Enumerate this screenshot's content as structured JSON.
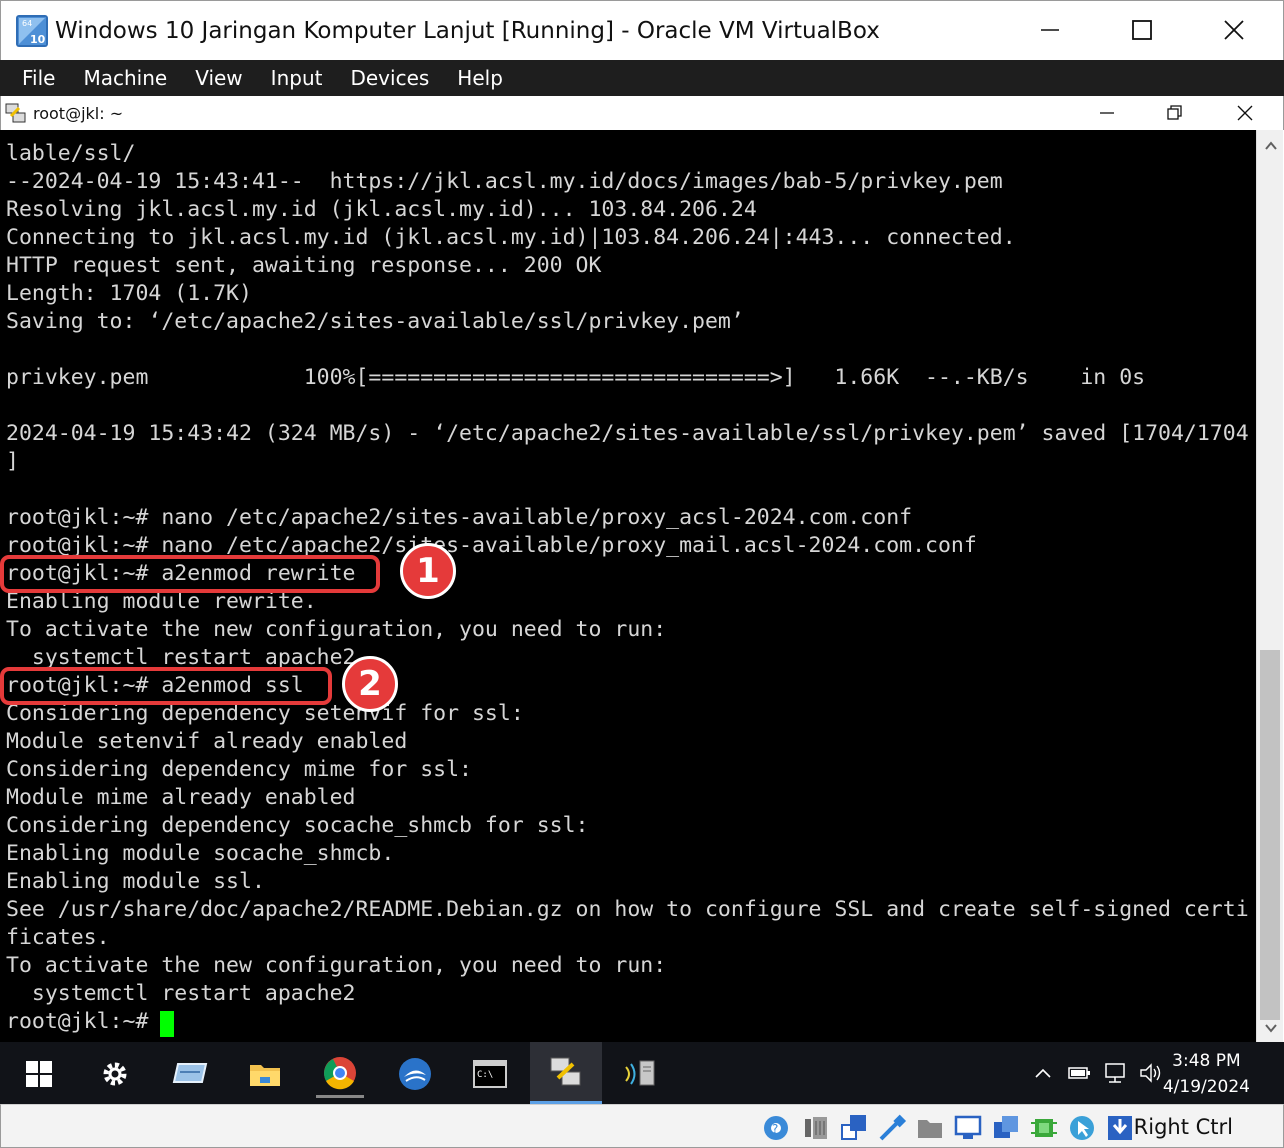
{
  "window": {
    "title": "Windows 10 Jaringan Komputer Lanjut [Running] - Oracle VM VirtualBox",
    "icon_badge_top": "64",
    "icon_badge_bottom": "10"
  },
  "menubar": {
    "items": [
      {
        "label": "File"
      },
      {
        "label": "Machine"
      },
      {
        "label": "View"
      },
      {
        "label": "Input"
      },
      {
        "label": "Devices"
      },
      {
        "label": "Help"
      }
    ]
  },
  "putty": {
    "title": "root@jkl: ~"
  },
  "terminal": {
    "lines": [
      "lable/ssl/",
      "--2024-04-19 15:43:41--  https://jkl.acsl.my.id/docs/images/bab-5/privkey.pem",
      "Resolving jkl.acsl.my.id (jkl.acsl.my.id)... 103.84.206.24",
      "Connecting to jkl.acsl.my.id (jkl.acsl.my.id)|103.84.206.24|:443... connected.",
      "HTTP request sent, awaiting response... 200 OK",
      "Length: 1704 (1.7K)",
      "Saving to: ‘/etc/apache2/sites-available/ssl/privkey.pem’",
      "",
      "privkey.pem            100%[===============================>]   1.66K  --.-KB/s    in 0s",
      "",
      "2024-04-19 15:43:42 (324 MB/s) - ‘/etc/apache2/sites-available/ssl/privkey.pem’ saved [1704/1704",
      "]",
      "",
      "root@jkl:~# nano /etc/apache2/sites-available/proxy_acsl-2024.com.conf",
      "root@jkl:~# nano /etc/apache2/sites-available/proxy_mail.acsl-2024.com.conf",
      "root@jkl:~# a2enmod rewrite",
      "Enabling module rewrite.",
      "To activate the new configuration, you need to run:",
      "  systemctl restart apache2",
      "root@jkl:~# a2enmod ssl",
      "Considering dependency setenvif for ssl:",
      "Module setenvif already enabled",
      "Considering dependency mime for ssl:",
      "Module mime already enabled",
      "Considering dependency socache_shmcb for ssl:",
      "Enabling module socache_shmcb.",
      "Enabling module ssl.",
      "See /usr/share/doc/apache2/README.Debian.gz on how to configure SSL and create self-signed certi",
      "ficates.",
      "To activate the new configuration, you need to run:",
      "  systemctl restart apache2",
      "root@jkl:~# "
    ]
  },
  "annotations": {
    "badge1": "1",
    "badge2": "2"
  },
  "taskbar": {
    "clock_time": "3:48 PM",
    "clock_date": "4/19/2024",
    "apps": [
      {
        "icon": "windows-start-icon"
      },
      {
        "icon": "settings-gear-icon"
      },
      {
        "icon": "network-drive-icon"
      },
      {
        "icon": "file-explorer-icon"
      },
      {
        "icon": "chrome-icon"
      },
      {
        "icon": "bird-app-icon"
      },
      {
        "icon": "command-prompt-icon"
      },
      {
        "icon": "putty-icon"
      },
      {
        "icon": "network-wizard-icon"
      }
    ]
  },
  "statusbar": {
    "host_key": "Right Ctrl"
  },
  "colors": {
    "terminal_bg": "#000000",
    "terminal_fg": "#d6d6d6",
    "cursor": "#00ff00",
    "annotation_red": "#e53a3a",
    "menubar_bg": "#1e1e1e",
    "taskbar_bg": "#111318"
  }
}
